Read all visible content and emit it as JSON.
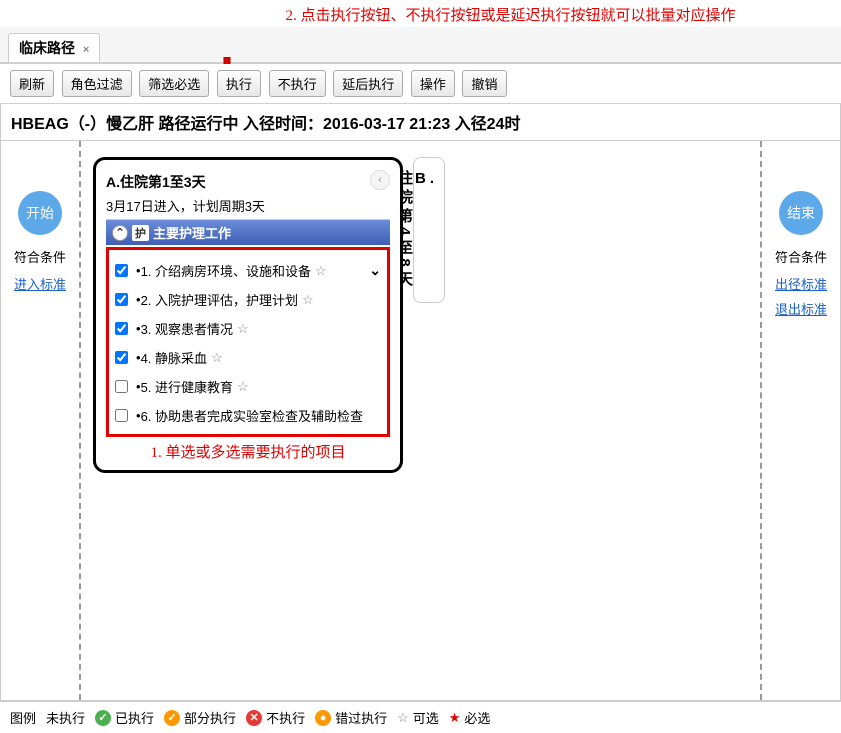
{
  "annotations": {
    "top": "2. 点击执行按钮、不执行按钮或是延迟执行按钮就可以批量对应操作",
    "bottom": "1. 单选或多选需要执行的项目"
  },
  "tab": {
    "title": "临床路径",
    "close": "×"
  },
  "toolbar": {
    "refresh": "刷新",
    "role_filter": "角色过滤",
    "filter_required": "筛选必选",
    "execute": "执行",
    "not_execute": "不执行",
    "delay_execute": "延后执行",
    "operate": "操作",
    "undo": "撤销"
  },
  "header": "HBEAG（-）慢乙肝   路径运行中 入径时间：2016-03-17 21:23 入径24时",
  "left": {
    "badge": "开始",
    "text": "符合条件",
    "link": "进入标准"
  },
  "right": {
    "badge": "结束",
    "text": "符合条件",
    "link1": "出径标准",
    "link2": "退出标准"
  },
  "card_a": {
    "title": "A.住院第1至3天",
    "subtitle": "3月17日进入，计划周期3天",
    "section_tag": "护",
    "section_title": "主要护理工作",
    "tasks": [
      {
        "label": "1. 介绍病房环境、设施和设备",
        "checked": true,
        "star": true,
        "dropdown": true
      },
      {
        "label": "2. 入院护理评估，护理计划",
        "checked": true,
        "star": true
      },
      {
        "label": "3. 观察患者情况",
        "checked": true,
        "star": true
      },
      {
        "label": "4. 静脉采血",
        "checked": true,
        "star": true
      },
      {
        "label": "5. 进行健康教育",
        "checked": false,
        "star": true
      },
      {
        "label": "6. 协助患者完成实验室检查及辅助检查",
        "checked": false,
        "star": false
      }
    ]
  },
  "card_b": {
    "label": "B.",
    "text": "住院第4至8天"
  },
  "legend": {
    "title": "图例",
    "not_exec": "未执行",
    "executed": "已执行",
    "partial": "部分执行",
    "no_exec": "不执行",
    "missed": "错过执行",
    "optional": "可选",
    "required": "必选"
  }
}
